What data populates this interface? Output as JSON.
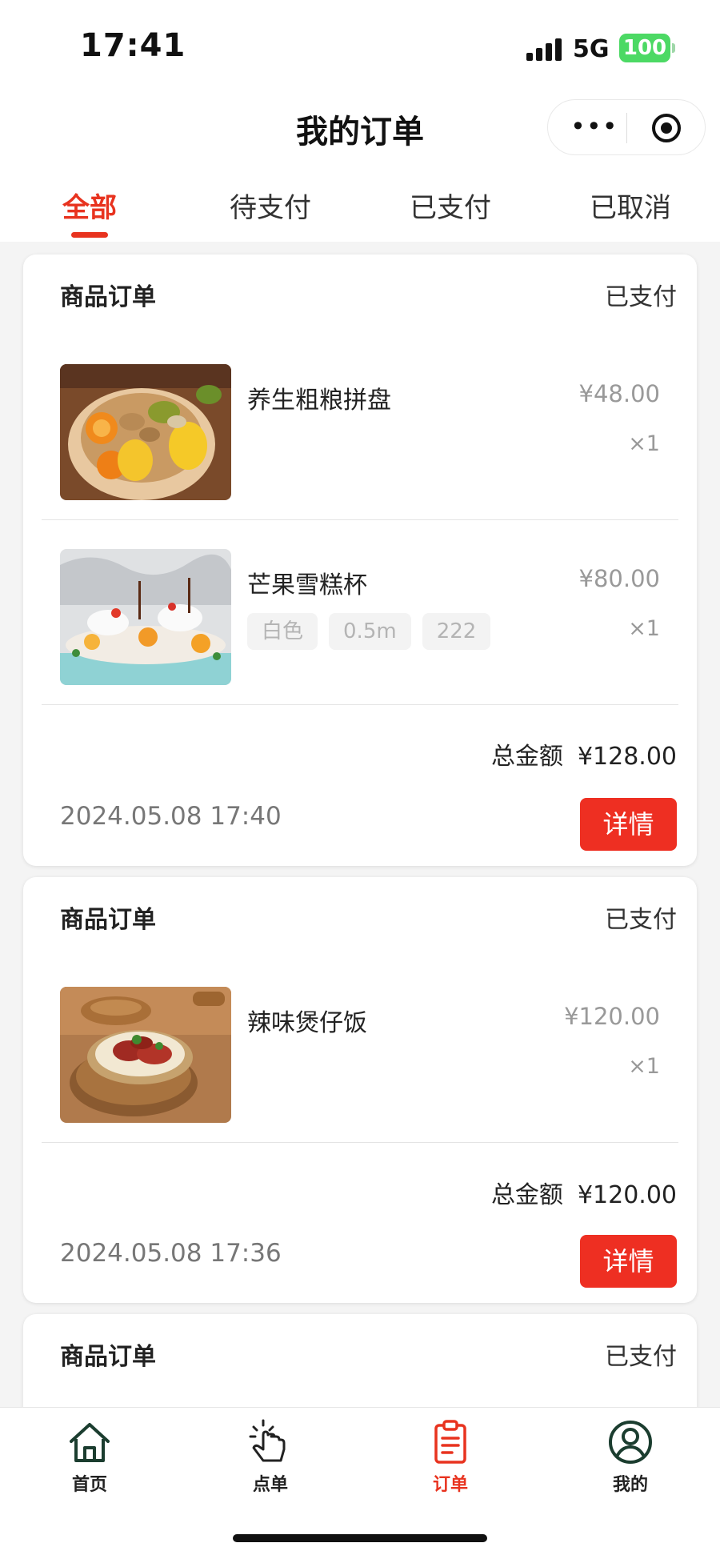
{
  "status_bar": {
    "time": "17:41",
    "network": "5G",
    "battery": "100"
  },
  "nav": {
    "title": "我的订单",
    "more_icon": "•••",
    "target_icon": "record-icon"
  },
  "tabs": [
    {
      "label": "全部",
      "active": true
    },
    {
      "label": "待支付",
      "active": false
    },
    {
      "label": "已支付",
      "active": false
    },
    {
      "label": "已取消",
      "active": false
    }
  ],
  "orders": [
    {
      "type": "商品订单",
      "status": "已支付",
      "items": [
        {
          "name": "养生粗粮拼盘",
          "price": "¥48.00",
          "qty": "×1",
          "specs": [],
          "image": "steamer-platter"
        },
        {
          "name": "芒果雪糕杯",
          "price": "¥80.00",
          "qty": "×1",
          "specs": [
            "白色",
            "0.5m",
            "222"
          ],
          "image": "mango-dessert"
        }
      ],
      "total_label": "总金额",
      "total": "¥128.00",
      "time": "2024.05.08 17:40",
      "detail_label": "详情"
    },
    {
      "type": "商品订单",
      "status": "已支付",
      "items": [
        {
          "name": "辣味煲仔饭",
          "price": "¥120.00",
          "qty": "×1",
          "specs": [],
          "image": "claypot-rice"
        }
      ],
      "total_label": "总金额",
      "total": "¥120.00",
      "time": "2024.05.08 17:36",
      "detail_label": "详情"
    },
    {
      "type": "商品订单",
      "status": "已支付"
    }
  ],
  "tabbar": [
    {
      "label": "首页",
      "icon": "home-icon",
      "active": false
    },
    {
      "label": "点单",
      "icon": "tap-hand-icon",
      "active": false
    },
    {
      "label": "订单",
      "icon": "clipboard-icon",
      "active": true
    },
    {
      "label": "我的",
      "icon": "user-icon",
      "active": false
    }
  ],
  "colors": {
    "accent": "#e8331f",
    "button": "#ee2f22",
    "battery": "#4cd964",
    "page_bg": "#f4f4f4"
  }
}
